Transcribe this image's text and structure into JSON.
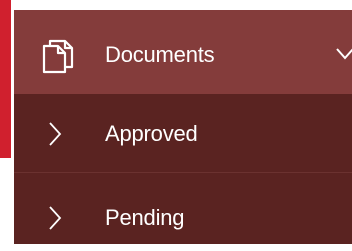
{
  "menu": {
    "header": {
      "label": "Documents",
      "icon": "documents-icon",
      "expand_icon": "chevron-down-icon"
    },
    "items": [
      {
        "label": "Approved",
        "icon": "chevron-right-icon"
      },
      {
        "label": "Pending",
        "icon": "chevron-right-icon"
      }
    ]
  },
  "colors": {
    "accent": "#d0202e",
    "header_bg": "#843c3b",
    "submenu_bg": "#5a2321",
    "text": "#ffffff"
  }
}
